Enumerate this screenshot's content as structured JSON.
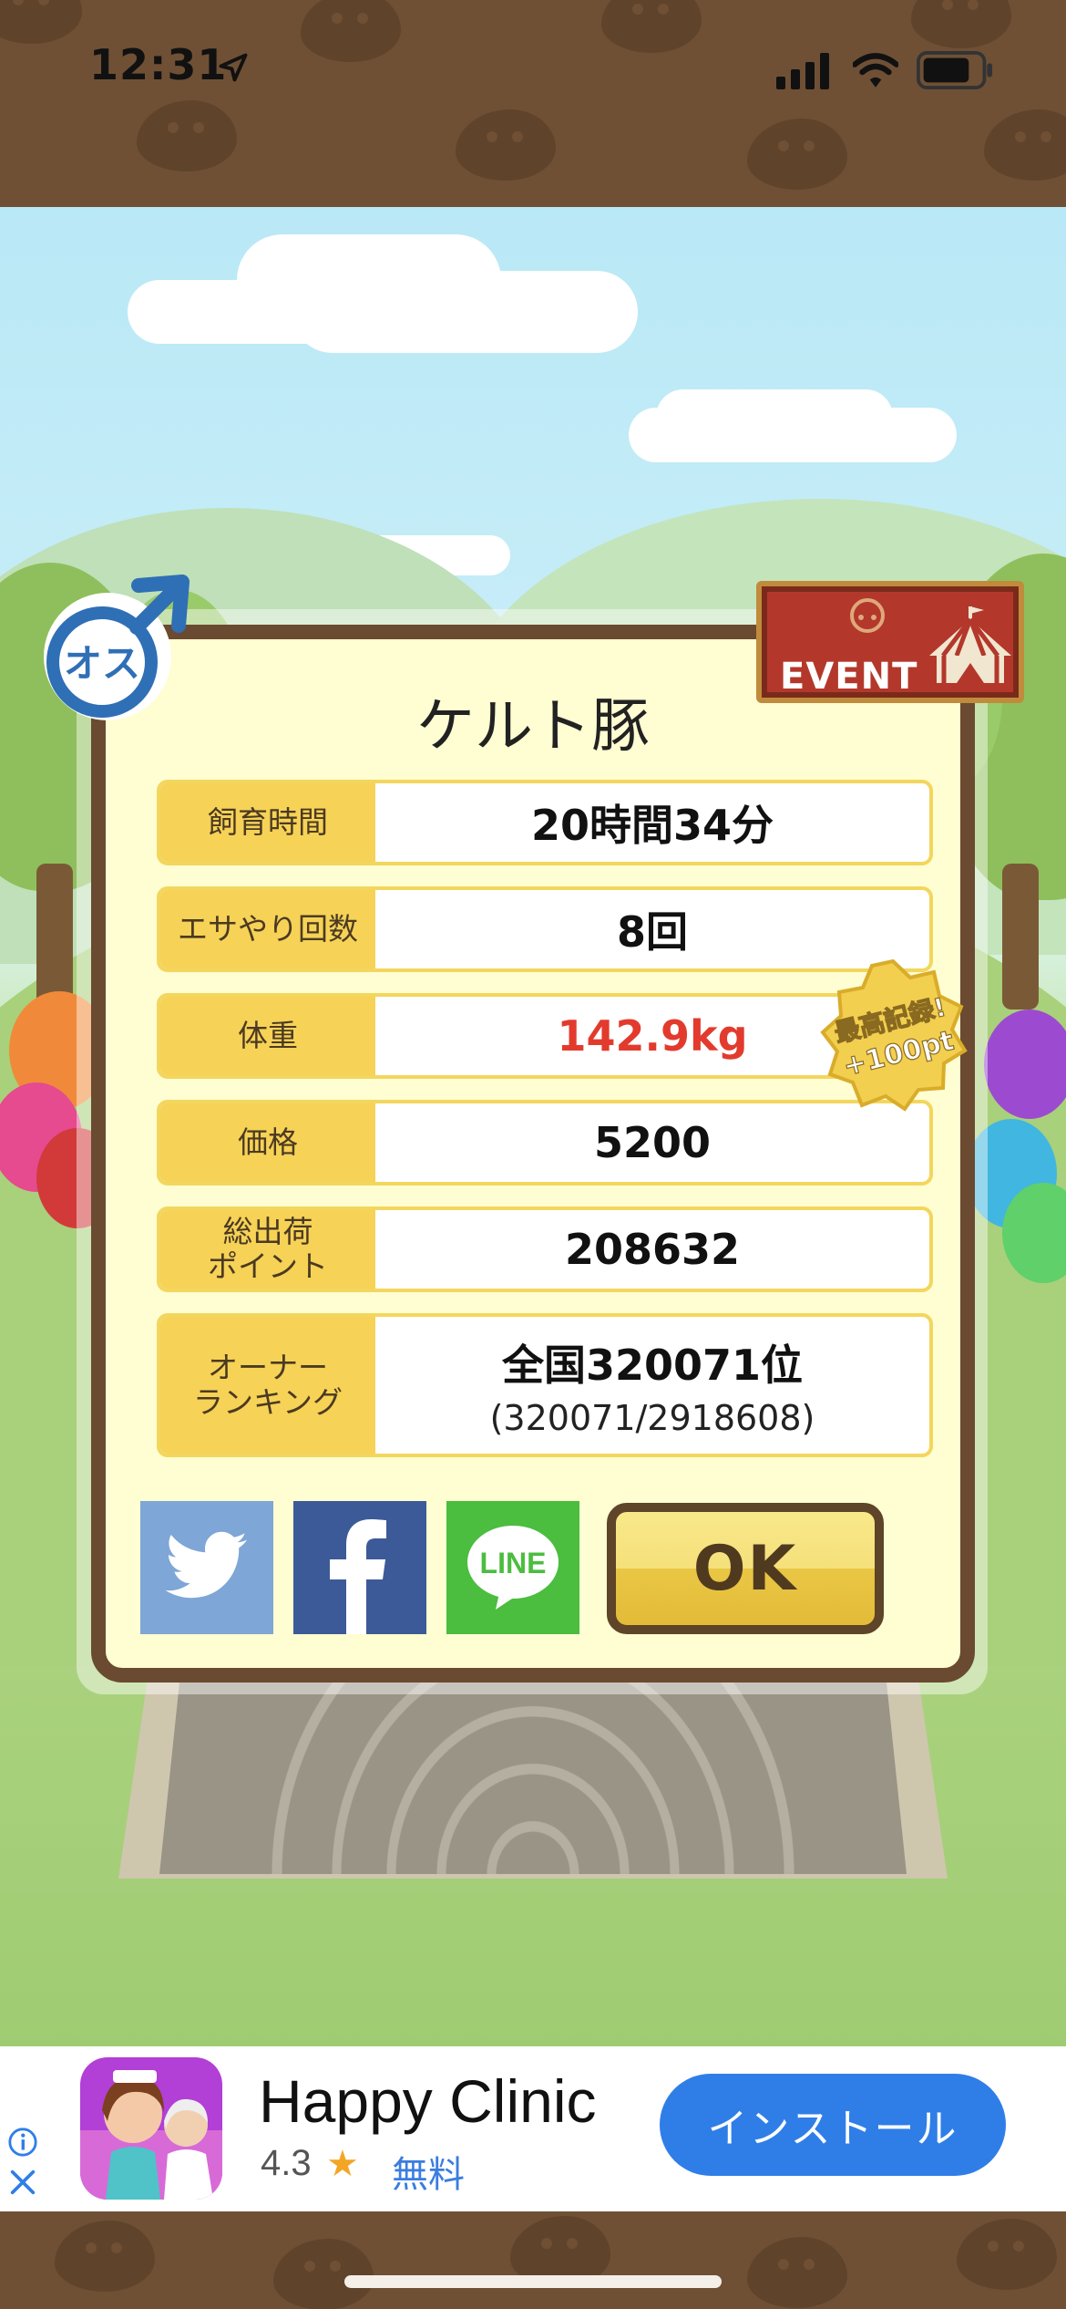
{
  "status_bar": {
    "time": "12:31",
    "location_icon": "location-arrow-icon",
    "signal_icon": "cellular-signal-icon",
    "wifi_icon": "wifi-icon",
    "battery_icon": "battery-icon"
  },
  "dialog": {
    "title": "ケルト豚",
    "gender_badge": "オス",
    "event_badge": "EVENT",
    "record_badge": "最高記録!+100pt",
    "rows": [
      {
        "label": "飼育時間",
        "value": "20時間34分"
      },
      {
        "label": "エサやり回数",
        "value": "8回"
      },
      {
        "label": "体重",
        "value": "142.9kg",
        "highlight": "#e23b2e"
      },
      {
        "label": "価格",
        "value": "5200"
      },
      {
        "label": "総出荷\nポイント",
        "value": "208632"
      }
    ],
    "ranking": {
      "label": "オーナー\nランキング",
      "main": "全国320071位",
      "sub": "(320071/2918608)"
    },
    "share": {
      "twitter_icon": "twitter-icon",
      "facebook_icon": "facebook-icon",
      "line_label": "LINE"
    },
    "ok_label": "OK"
  },
  "ad": {
    "title": "Happy Clinic",
    "rating": "4.3",
    "star": "★",
    "price": "無料",
    "install_label": "インストール",
    "info_icon": "ad-info-icon",
    "close_icon": "close-icon"
  },
  "colors": {
    "brown_band": "#6f5035",
    "dialog_bg": "#fffdd2",
    "label_bg": "#f6d256",
    "accent_red": "#e23b2e",
    "install_blue": "#2f7ee8"
  }
}
